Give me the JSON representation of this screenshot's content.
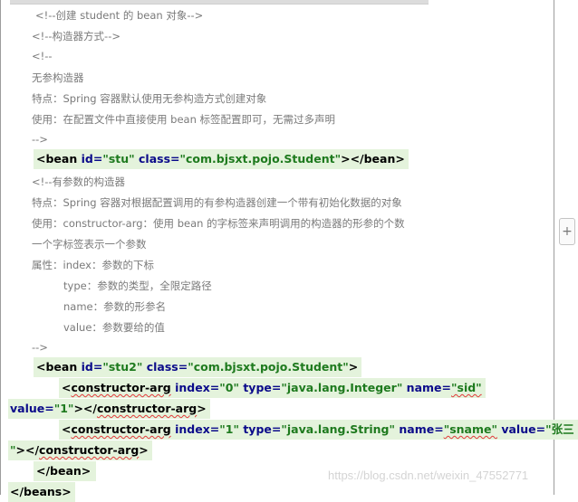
{
  "comments": {
    "create": "<!--创建 student 的 bean 对象-->",
    "ctor_way": "<!--构造器方式-->",
    "open": "<!--",
    "noarg": "无参构造器",
    "noarg_feature": "特点：Spring 容器默认使用无参构造方式创建对象",
    "noarg_use": "使用：在配置文件中直接使用 bean 标签配置即可，无需过多声明",
    "close1": "-->",
    "argctor": "<!--有参数的构造器",
    "arg_feature": "特点：Spring 容器对根据配置调用的有参构造器创建一个带有初始化数据的对象",
    "arg_use": "使用：constructor-arg：使用 bean 的字标签来声明调用的构造器的形参的个数",
    "arg_one": "一个字标签表示一个参数",
    "attr": "属性：index：参数的下标",
    "type": "type：参数的类型，全限定路径",
    "name": "name：参数的形参名",
    "value": "value：参数要给的值",
    "close2": "-->"
  },
  "bean1": {
    "open": "<",
    "tag": "bean",
    "id_attr": " id=",
    "id_val": "\"stu\"",
    "class_attr": " class=",
    "class_val": "\"com.bjsxt.pojo.Student\"",
    "end": "></",
    "tag2": "bean",
    "close": ">"
  },
  "bean2": {
    "open": "<",
    "tag": "bean",
    "id_attr": " id=",
    "id_val": "\"stu2\"",
    "class_attr": " class=",
    "class_val": "\"com.bjsxt.pojo.Student\"",
    "close": ">"
  },
  "arg0": {
    "open": "<",
    "tag": "constructor-arg",
    "index_attr": " index=",
    "index_val": "\"0\"",
    "type_attr": " type=",
    "type_val": "\"java.lang.Integer\"",
    "name_attr": " name=",
    "name_val": "\"sid\"",
    "value_attr": "value=",
    "value_val": "\"1\"",
    "end": "></",
    "tag2": "constructor-arg",
    "close": ">"
  },
  "arg1": {
    "open": "<",
    "tag": "constructor-arg",
    "index_attr": " index=",
    "index_val": "\"1\"",
    "type_attr": " type=",
    "type_val": "\"java.lang.String\"",
    "name_attr": " name=",
    "name_val": "\"sname\"",
    "value_attr": " value=",
    "value_val": "\"张三",
    "value_val2": "\"",
    "end": "></",
    "tag2": "constructor-arg",
    "close": ">"
  },
  "bean_end": "</bean>",
  "beans_end": "</beans>",
  "expand_button": "+",
  "watermark": "https://blog.csdn.net/weixin_47552771"
}
